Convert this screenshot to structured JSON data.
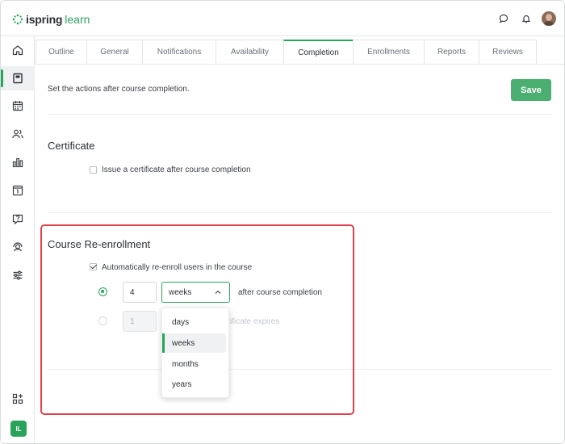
{
  "app": {
    "logo_brand": "ispring",
    "logo_product": "learn"
  },
  "rail": {
    "user_initials": "IL"
  },
  "tabs": [
    {
      "label": "Outline"
    },
    {
      "label": "General"
    },
    {
      "label": "Notifications"
    },
    {
      "label": "Availability"
    },
    {
      "label": "Completion",
      "active": true
    },
    {
      "label": "Enrollments"
    },
    {
      "label": "Reports"
    },
    {
      "label": "Reviews"
    }
  ],
  "page": {
    "hint": "Set the actions after course completion.",
    "save_label": "Save"
  },
  "certificate": {
    "title": "Certificate",
    "issue_label": "Issue a certificate after course completion",
    "issue_checked": false
  },
  "reenroll": {
    "title": "Course Re-enrollment",
    "auto_label": "Automatically re-enroll users in the course",
    "auto_checked": true,
    "option1": {
      "value": "4",
      "unit": "weeks",
      "suffix": "after course completion",
      "selected": true
    },
    "option2": {
      "value": "1",
      "suffix_visible": "rtificate expires",
      "selected": false
    },
    "unit_options": [
      "days",
      "weeks",
      "months",
      "years"
    ],
    "unit_selected": "weeks"
  },
  "colors": {
    "accent": "#2aa35a",
    "save_button": "#4caf72",
    "highlight": "#e0424c"
  }
}
